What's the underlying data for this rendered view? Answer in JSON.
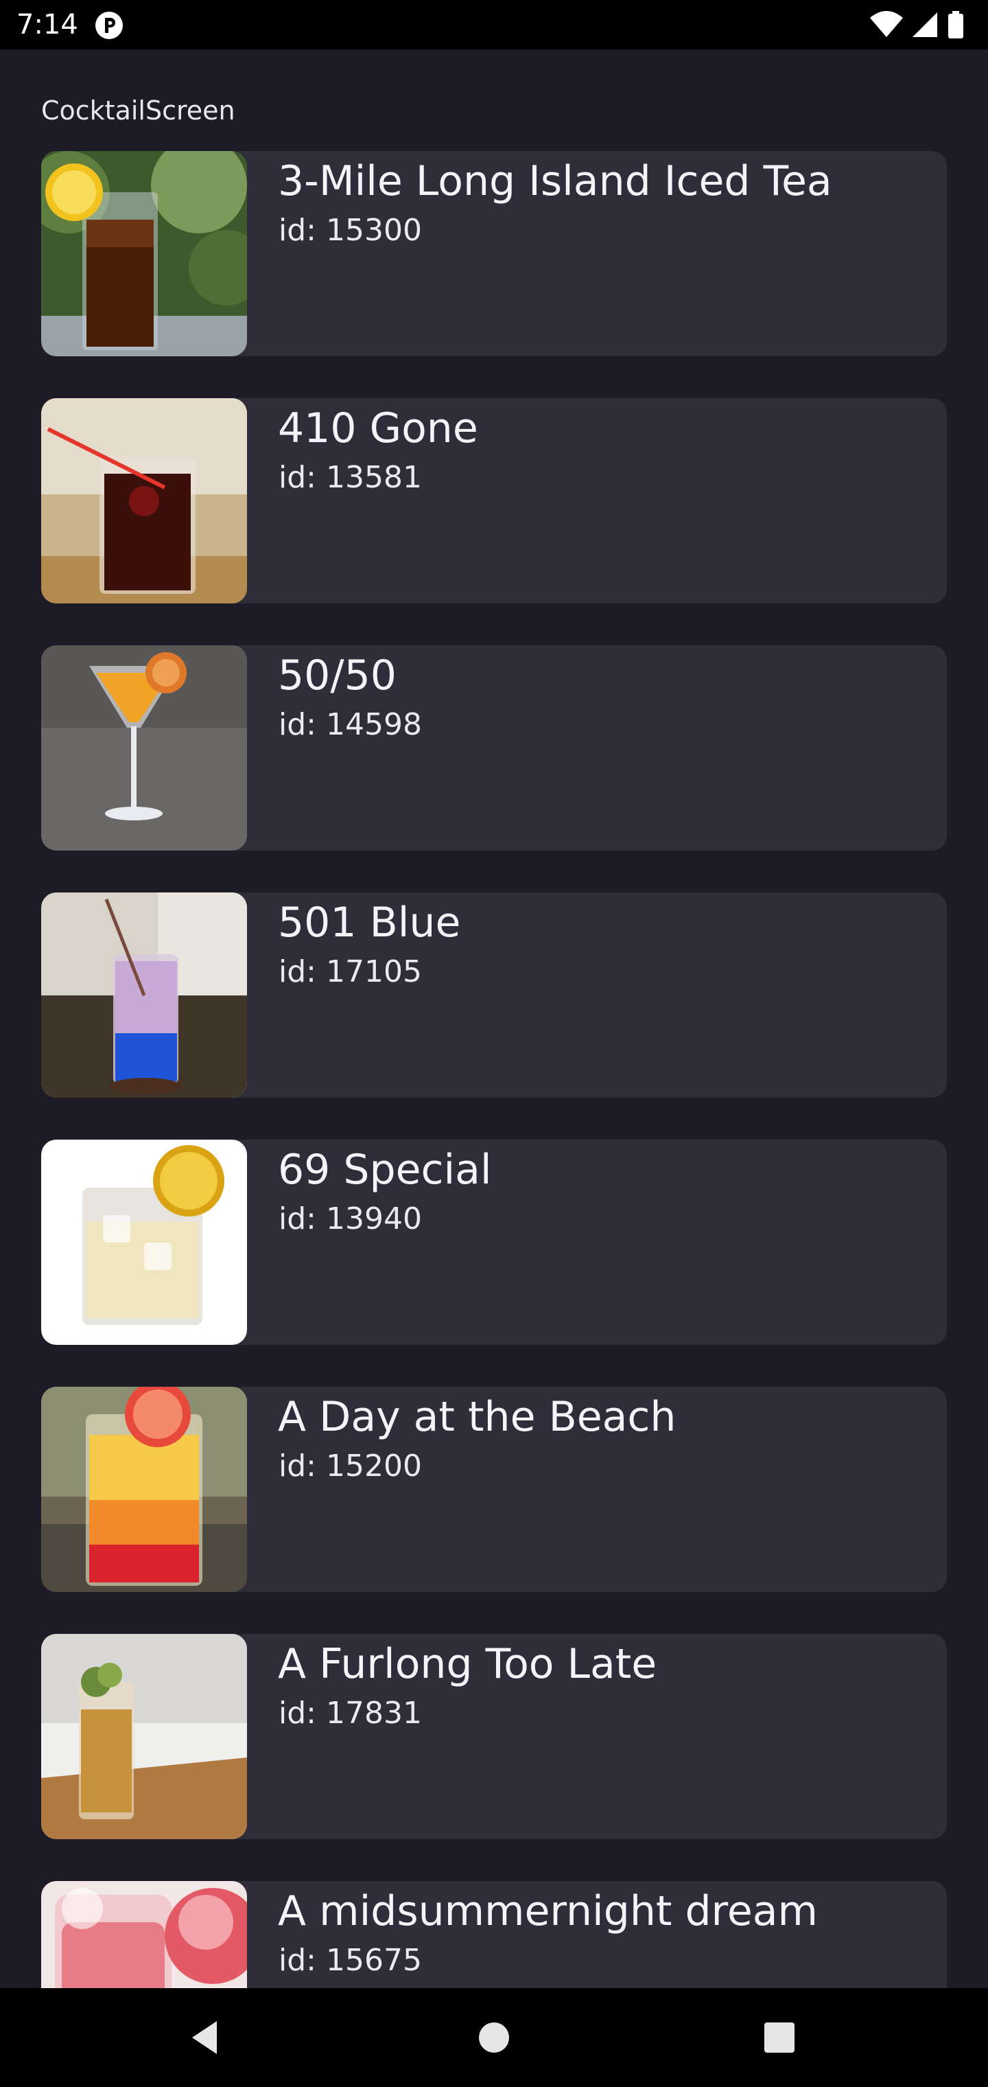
{
  "status_bar": {
    "time": "7:14",
    "app_icon": "parking-p-icon",
    "icons": [
      "wifi-icon",
      "cell-signal-icon",
      "battery-icon"
    ]
  },
  "screen": {
    "title": "CocktailScreen",
    "background": "#1d1b26",
    "card_color": "#2f2d3a"
  },
  "cocktails": [
    {
      "name": "3-Mile Long Island Iced Tea",
      "id_label": "id: 15300"
    },
    {
      "name": "410 Gone",
      "id_label": "id: 13581"
    },
    {
      "name": "50/50",
      "id_label": "id: 14598"
    },
    {
      "name": "501 Blue",
      "id_label": "id: 17105"
    },
    {
      "name": "69 Special",
      "id_label": "id: 13940"
    },
    {
      "name": "A Day at the Beach",
      "id_label": "id: 15200"
    },
    {
      "name": "A Furlong Too Late",
      "id_label": "id: 17831"
    },
    {
      "name": "A midsummernight dream",
      "id_label": "id: 15675"
    }
  ],
  "nav_bar": {
    "buttons": [
      "back-icon",
      "home-icon",
      "recents-icon"
    ]
  }
}
